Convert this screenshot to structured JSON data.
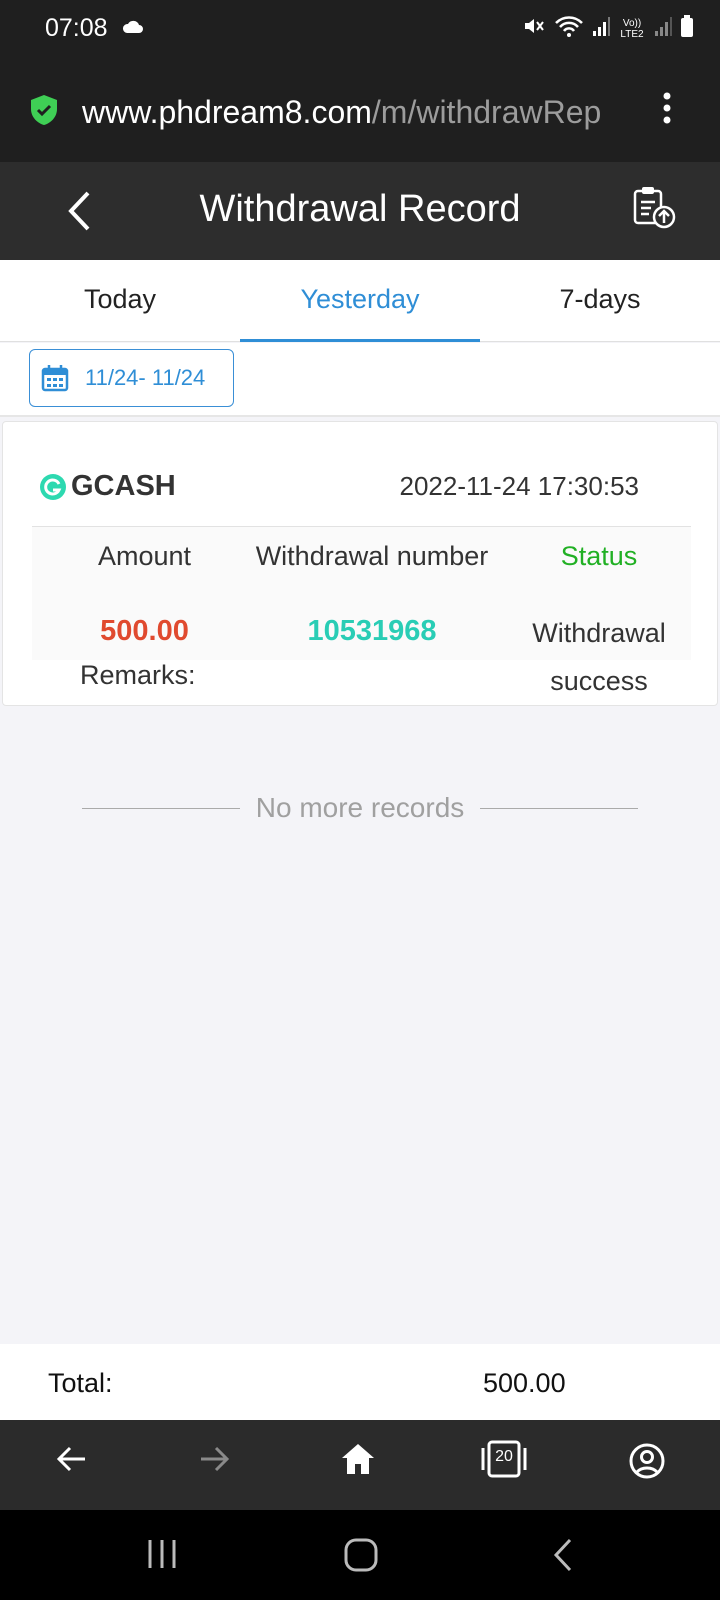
{
  "status_bar": {
    "time": "07:08",
    "network_label": "Vo)) LTE2"
  },
  "browser": {
    "url_host": "www.phdream8.com",
    "url_path": "/m/withdrawRep"
  },
  "header": {
    "title": "Withdrawal Record"
  },
  "tabs": [
    {
      "label": "Today",
      "active": false
    },
    {
      "label": "Yesterday",
      "active": true
    },
    {
      "label": "7-days",
      "active": false
    }
  ],
  "date_range": "11/24- 11/24",
  "record": {
    "method": "GCASH",
    "datetime": "2022-11-24 17:30:53",
    "headers": {
      "amount": "Amount",
      "number": "Withdrawal number",
      "status": "Status"
    },
    "amount": "500.00",
    "number": "10531968",
    "status_line1": "Withdrawal",
    "status_line2": "success",
    "remarks_label": "Remarks:"
  },
  "no_more_text": "No more records",
  "total": {
    "label": "Total:",
    "value": "500.00"
  },
  "tab_count": "20",
  "colors": {
    "accent": "#2f8ed6",
    "amount": "#e04a2f",
    "number": "#29cdb5",
    "status": "#21b024",
    "gcash": "#2dd9b0"
  }
}
